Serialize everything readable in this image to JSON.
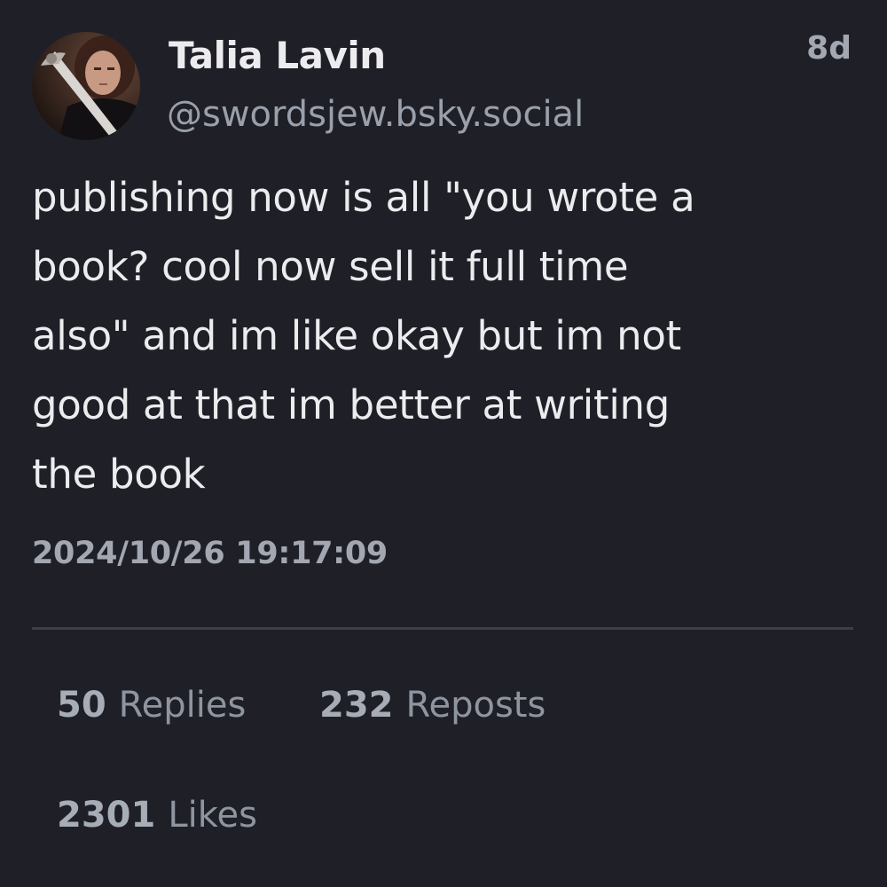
{
  "author": {
    "display_name": "Talia Lavin",
    "handle": "@swordsjew.bsky.social",
    "avatar_icon": "profile-photo"
  },
  "post": {
    "relative_time": "8d",
    "text": "publishing now is all \"you wrote a\nbook? cool now sell it full time\nalso\" and im like okay but im not\ngood at that im better at writing\nthe book",
    "timestamp": "2024/10/26 19:17:09"
  },
  "stats": {
    "replies_count": "50",
    "replies_label": "Replies",
    "reposts_count": "232",
    "reposts_label": "Reposts",
    "likes_count": "2301",
    "likes_label": "Likes"
  },
  "colors": {
    "background": "#1f2027",
    "text_primary": "#ececef",
    "text_secondary": "#9aa0ab",
    "divider": "#3b3f49"
  }
}
